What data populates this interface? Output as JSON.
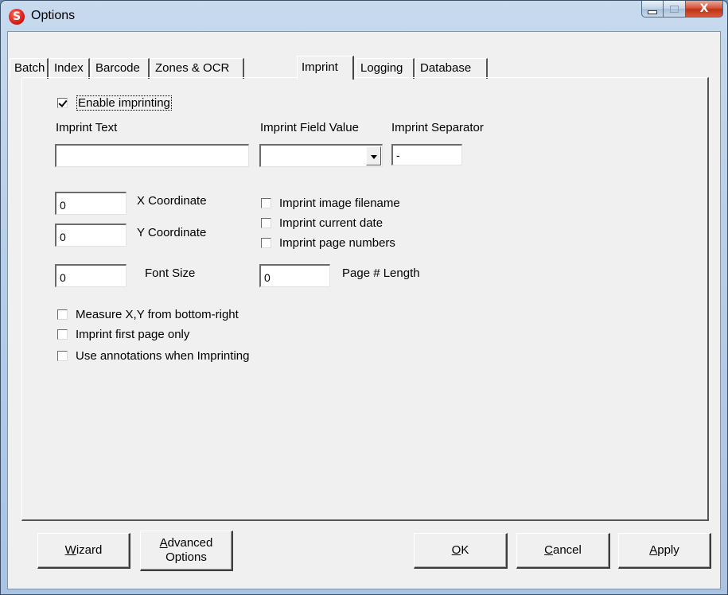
{
  "window": {
    "title": "Options",
    "app_icon_letter": "S",
    "close_glyph": "X"
  },
  "tabs": [
    {
      "label": "Batch"
    },
    {
      "label": "Index"
    },
    {
      "label": "Barcode"
    },
    {
      "label": "Zones & OCR"
    },
    {
      "label": "Imprint"
    },
    {
      "label": "Logging"
    },
    {
      "label": "Database"
    }
  ],
  "active_tab": "Imprint",
  "imprint": {
    "enable_imprinting": {
      "label": "Enable imprinting",
      "checked": true
    },
    "imprint_text": {
      "label": "Imprint Text",
      "value": ""
    },
    "imprint_field_value": {
      "label": "Imprint Field Value",
      "selected": ""
    },
    "imprint_separator": {
      "label": "Imprint Separator",
      "value": "-"
    },
    "x_coordinate": {
      "label": "X Coordinate",
      "value": "0"
    },
    "y_coordinate": {
      "label": "Y Coordinate",
      "value": "0"
    },
    "font_size": {
      "label": "Font Size",
      "value": "0"
    },
    "page_number_length": {
      "label": "Page # Length",
      "value": "0"
    },
    "options_right": [
      {
        "label": "Imprint image filename",
        "checked": false
      },
      {
        "label": "Imprint current date",
        "checked": false
      },
      {
        "label": "Imprint page numbers",
        "checked": false
      }
    ],
    "options_bottom": [
      {
        "label": "Measure X,Y from bottom-right",
        "checked": false
      },
      {
        "label": "Imprint first page only",
        "checked": false
      },
      {
        "label": "Use annotations when Imprinting",
        "checked": false
      }
    ]
  },
  "buttons": {
    "wizard": {
      "mnemonic": "W",
      "rest": "izard"
    },
    "advanced": {
      "mnemonic": "A",
      "rest_line1": "dvanced",
      "line2": "Options"
    },
    "ok": {
      "mnemonic": "O",
      "rest": "K"
    },
    "cancel": {
      "mnemonic": "C",
      "rest": "ancel"
    },
    "apply": {
      "mnemonic": "A",
      "rest": "pply"
    }
  }
}
